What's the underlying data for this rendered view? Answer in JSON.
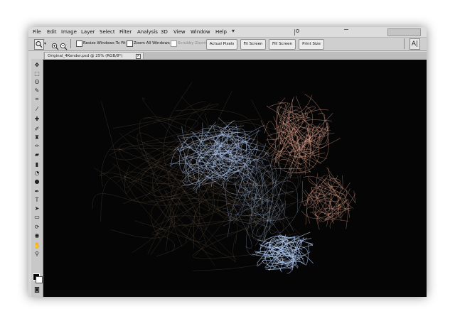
{
  "menu": {
    "items": [
      "File",
      "Edit",
      "Image",
      "Layer",
      "Select",
      "Filter",
      "Analysis",
      "3D",
      "View",
      "Window",
      "Help"
    ]
  },
  "options": {
    "resize_windows_label": "Resize Windows To Fit",
    "zoom_all_windows_label": "Zoom All Windows",
    "scrubby_zoom_label": "Scrubby Zoom",
    "actual_pixels_label": "Actual Pixels",
    "fit_screen_label": "Fit Screen",
    "fill_screen_label": "Fill Screen",
    "print_size_label": "Print Size"
  },
  "document": {
    "tab_title": "Original_4Kender.psd @ 25% (RGB/8*)"
  },
  "icons": {
    "zoom_tool": "magnifier-icon",
    "zoom_in": "zoom-in-icon",
    "zoom_out": "zoom-out-icon",
    "panel_icon": "type-panel-icon"
  },
  "colors": {
    "canvas_bg": "#050505",
    "strands_blue": "#b9d4ff",
    "strands_pink": "#e8a890",
    "strands_dim": "#6e5a48"
  }
}
